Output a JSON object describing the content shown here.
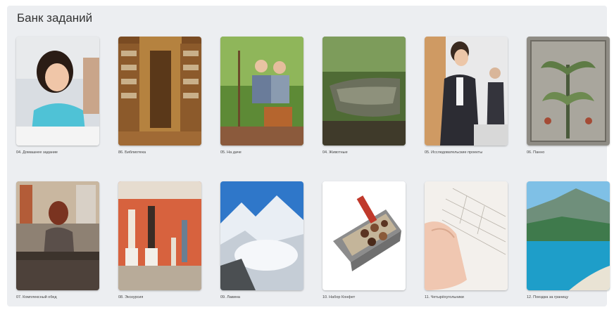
{
  "page": {
    "title": "Банк заданий"
  },
  "cards": [
    {
      "caption": "04. Домашнее задание",
      "icon": "child-homework-photo"
    },
    {
      "caption": "86. Библиотека",
      "icon": "library-photo"
    },
    {
      "caption": "05. На даче",
      "icon": "garden-photo"
    },
    {
      "caption": "04. Животные",
      "icon": "crocodile-photo"
    },
    {
      "caption": "05. Исследовательские проекты",
      "icon": "presentation-photo"
    },
    {
      "caption": "06. Панно",
      "icon": "mosaic-photo"
    },
    {
      "caption": "07. Комплексный обед",
      "icon": "cafe-photo"
    },
    {
      "caption": "08. Экскурсия",
      "icon": "museum-photo"
    },
    {
      "caption": "09. Лавина",
      "icon": "avalanche-photo"
    },
    {
      "caption": "10. Набор Конфет",
      "icon": "chocolate-box-photo"
    },
    {
      "caption": "11. Четырёхугольники",
      "icon": "geometry-paper-photo"
    },
    {
      "caption": "12. Поездка за границу",
      "icon": "coast-photo"
    }
  ]
}
